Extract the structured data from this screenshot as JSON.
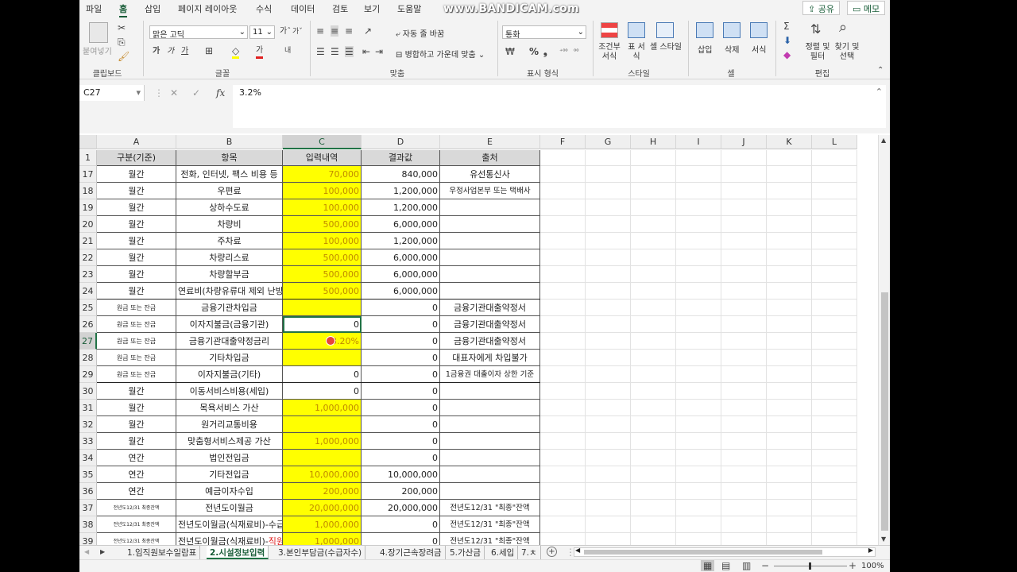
{
  "menu": [
    "파일",
    "홈",
    "삽입",
    "페이지 레이아웃",
    "수식",
    "데이터",
    "검토",
    "보기",
    "도움말"
  ],
  "watermark": "www.BANDICAM.com",
  "share_label": "공유",
  "memo_label": "메모",
  "ribbon": {
    "clipboard": {
      "paste": "붙여넣기",
      "label": "클립보드"
    },
    "font": {
      "name": "맑은 고딕",
      "size": "11",
      "label": "글꼴"
    },
    "align": {
      "wrap": "자동 줄 바꿈",
      "merge": "병합하고 가운데 맞춤",
      "label": "맞춤"
    },
    "number": {
      "format": "통화",
      "label": "표시 형식"
    },
    "styles": {
      "cond": "조건부 서식",
      "table": "표 서식",
      "cell": "셀 스타일",
      "label": "스타일"
    },
    "cells": {
      "insert": "삽입",
      "delete": "삭제",
      "format": "서식",
      "label": "셀"
    },
    "edit": {
      "sort": "정렬 및 필터",
      "find": "찾기 및 선택",
      "label": "편집"
    }
  },
  "formula_bar": {
    "cell_ref": "C27",
    "fx": "fx",
    "value": "3.2%"
  },
  "columns": [
    "A",
    "B",
    "C",
    "D",
    "E",
    "F",
    "G",
    "H",
    "I",
    "J",
    "K",
    "L"
  ],
  "header_row": {
    "num": "1",
    "a": "구분(기준)",
    "b": "항목",
    "c": "입력내역",
    "d": "결과값",
    "e": "출처"
  },
  "rows": [
    {
      "num": "17",
      "a": "월간",
      "b": "전화, 인터넷, 팩스 비용 등",
      "c": "70,000",
      "d": "840,000",
      "e": "유선통신사"
    },
    {
      "num": "18",
      "a": "월간",
      "b": "우편료",
      "c": "100,000",
      "d": "1,200,000",
      "e": "우정사업본부 또는 택배사"
    },
    {
      "num": "19",
      "a": "월간",
      "b": "상하수도료",
      "c": "100,000",
      "d": "1,200,000",
      "e": ""
    },
    {
      "num": "20",
      "a": "월간",
      "b": "차량비",
      "c": "500,000",
      "d": "6,000,000",
      "e": ""
    },
    {
      "num": "21",
      "a": "월간",
      "b": "주차료",
      "c": "100,000",
      "d": "1,200,000",
      "e": ""
    },
    {
      "num": "22",
      "a": "월간",
      "b": "차량리스료",
      "c": "500,000",
      "d": "6,000,000",
      "e": ""
    },
    {
      "num": "23",
      "a": "월간",
      "b": "차량할부금",
      "c": "500,000",
      "d": "6,000,000",
      "e": ""
    },
    {
      "num": "24",
      "a": "월간",
      "b": "연료비(차량유류대 제외 난방비등)",
      "c": "500,000",
      "d": "6,000,000",
      "e": ""
    },
    {
      "num": "25",
      "a": "원금 또는 잔금",
      "b": "금융기관차입금",
      "c": "",
      "d": "0",
      "e": "금융기관대출약정서"
    },
    {
      "num": "26",
      "a": "원금 또는 잔금",
      "b": "이자지불금(금융기관)",
      "c": "0",
      "d": "0",
      "e": "금융기관대출약정서"
    },
    {
      "num": "27",
      "a": "원금 또는 잔금",
      "b": "금융기관대출약정금리",
      "c": "3.20%",
      "d": "0",
      "e": "금융기관대출약정서"
    },
    {
      "num": "28",
      "a": "원금 또는 잔금",
      "b": "기타차입금",
      "c": "",
      "d": "0",
      "e": "대표자에게 차입불가"
    },
    {
      "num": "29",
      "a": "원금 또는 잔금",
      "b": "이자지불금(기타)",
      "c": "0",
      "d": "0",
      "e": "1금융권 대출이자 상한 기준"
    },
    {
      "num": "30",
      "a": "월간",
      "b": "이동서비스비용(세입)",
      "c": "0",
      "d": "0",
      "e": ""
    },
    {
      "num": "31",
      "a": "월간",
      "b": "목욕서비스 가산",
      "c": "1,000,000",
      "d": "0",
      "e": ""
    },
    {
      "num": "32",
      "a": "월간",
      "b": "원거리교통비용",
      "c": "",
      "d": "0",
      "e": ""
    },
    {
      "num": "33",
      "a": "월간",
      "b": "맞춤형서비스제공 가산",
      "c": "1,000,000",
      "d": "0",
      "e": ""
    },
    {
      "num": "34",
      "a": "연간",
      "b": "법인전입금",
      "c": "",
      "d": "0",
      "e": ""
    },
    {
      "num": "35",
      "a": "연간",
      "b": "기타전입금",
      "c": "10,000,000",
      "d": "10,000,000",
      "e": ""
    },
    {
      "num": "36",
      "a": "연간",
      "b": "예금이자수입",
      "c": "200,000",
      "d": "200,000",
      "e": ""
    },
    {
      "num": "37",
      "a": "전년도12/31 최종잔액",
      "b": "전년도이월금",
      "c": "20,000,000",
      "d": "20,000,000",
      "e": "전년도12/31 \"최종\"잔액"
    },
    {
      "num": "38",
      "a": "전년도12/31 최종잔액",
      "b": "전년도이월금(식재료비)-수급자",
      "c": "1,000,000",
      "d": "0",
      "e": "전년도12/31 \"최종\"잔액"
    },
    {
      "num": "39",
      "a": "전년도12/31 최종잔액",
      "b": "전년도이월금(식재료비)-직원",
      "c": "1,000,000",
      "d": "0",
      "e": "전년도12/31 \"최종\"잔액"
    }
  ],
  "sheet_tabs": [
    "1.임직원보수일람표",
    "2.시설정보입력",
    "3.본인부담금(수급자수)",
    "4.장기근속장려금",
    "5.가산금",
    "6.세입",
    "7.ㅊ"
  ],
  "zoom": "100%"
}
